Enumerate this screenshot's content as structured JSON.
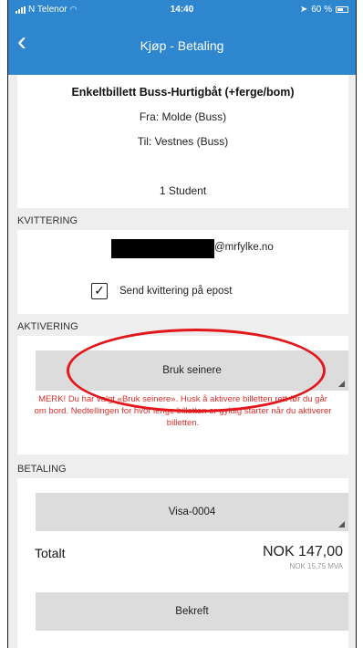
{
  "status_bar": {
    "carrier": "N Telenor",
    "time": "14:40",
    "battery": "60 %"
  },
  "nav": {
    "back_icon": "chevron-left-icon",
    "title": "Kjøp - Betaling"
  },
  "ticket": {
    "title": "Enkeltbillett Buss-Hurtigbåt (+ferge/bom)",
    "from": "Fra: Molde (Buss)",
    "to": "Til: Vestnes (Buss)",
    "passengers": "1 Student"
  },
  "receipt": {
    "section_label": "KVITTERING",
    "email_suffix": "@mrfylke.no",
    "send_checked": true,
    "send_label": "Send kvittering på epost"
  },
  "activation": {
    "section_label": "AKTIVERING",
    "button_label": "Bruk seinere",
    "warning": "MERK! Du har valgt «Bruk seinere». Husk å aktivere billetten rett før du går om bord. Nedtellingen for hvor lenge billetten er gyldig starter når du aktiverer billetten."
  },
  "payment": {
    "section_label": "BETALING",
    "card_label": "Visa-0004",
    "total_label": "Totalt",
    "total_amount": "NOK 147,00",
    "vat": "NOK 15,75 MVA",
    "confirm_label": "Bekreft"
  },
  "colors": {
    "header": "#2e86cf",
    "warning_text": "#d9302c",
    "highlight": "#e2161b"
  }
}
